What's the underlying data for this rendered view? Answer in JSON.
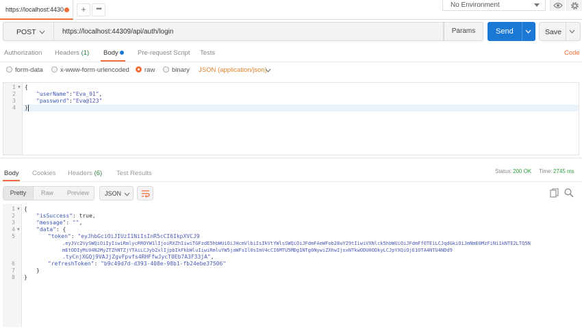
{
  "tab": {
    "title": "https://localhost:4430"
  },
  "environment": {
    "selected": "No Environment"
  },
  "request": {
    "method": "POST",
    "url": "https://localhost:44309/api/auth/login",
    "params_label": "Params",
    "send_label": "Send",
    "save_label": "Save"
  },
  "request_tabs": {
    "authorization": "Authorization",
    "headers": "Headers",
    "headers_count": "(1)",
    "body": "Body",
    "pre_request": "Pre-request Script",
    "tests": "Tests",
    "code": "Code"
  },
  "body_types": {
    "form_data": "form-data",
    "urlencoded": "x-www-form-urlencoded",
    "raw": "raw",
    "binary": "binary",
    "json_type": "JSON (application/json)",
    "selected": "raw"
  },
  "request_body": {
    "line_numbers": [
      "1",
      "2",
      "3",
      "4"
    ],
    "open": "{",
    "k1": "\"userName\"",
    "v1": "\"Eva_91\"",
    "k2": "\"password\"",
    "v2": "\"Eva@123\"",
    "close": "}"
  },
  "response_tabs": {
    "body": "Body",
    "cookies": "Cookies",
    "headers": "Headers",
    "headers_count": "(6)",
    "test_results": "Test Results"
  },
  "response_meta": {
    "status_label": "Status:",
    "status": "200 OK",
    "time_label": "Time:",
    "time": "2745 ms"
  },
  "view_modes": {
    "pretty": "Pretty",
    "raw": "Raw",
    "preview": "Preview",
    "format": "JSON"
  },
  "response_body": {
    "line_numbers": [
      "1",
      "2",
      "3",
      "4",
      "5",
      "6",
      "7",
      "8"
    ],
    "open": "{",
    "k_isSuccess": "\"isSuccess\"",
    "v_isSuccess": "true",
    "k_message": "\"message\"",
    "v_message": "\"\"",
    "k_data": "\"data\"",
    "k_token": "\"token\"",
    "token_1": "\"eyJhbGciOiJIUzI1NiIsInR5cCI6IkpXVCJ9",
    "token_2": ".eyJVc2VySWQiOiIyIiwiRmlycRROYW1lIjoiRXZhIiwiTGFzdE5hbWUiOiJHcmVlbiIsIkVtYWlsSWQiOiJFdmFAeWFob28uY29tIiwiVXNlck5hbWUiOiJFdmFfOTEiLCJqdGkiOiJmNmE0MzFiNi1kNTE2LTQ5N",
    "token_3": "mEtODIyMi04N2MyZTZhNTZjYTAiLCJyb2xlIjpbIkFkbWluIiwiRmluYW5jaWFsIl0sImV4cCI6MTU5MDg1NTg0NywiZXhwIjoxNTkwODU0ODkyLCJpYXQiOjE1OTA4NTU4NDd9",
    "token_4": ".tyCnjXGQj9VAJjZgvFpvfs4RHFfwJycT0Eb7A3F33jA\"",
    "k_refreshToken": "\"refreshToken\"",
    "v_refreshToken": "\"b9c49d7d-d393-408e-98b1-fb24ebe37506\"",
    "close_inner": "}",
    "close": "}"
  },
  "colors": {
    "accent": "#f26b3a",
    "send": "#1b78d4",
    "status_ok": "#2a9d3e"
  }
}
